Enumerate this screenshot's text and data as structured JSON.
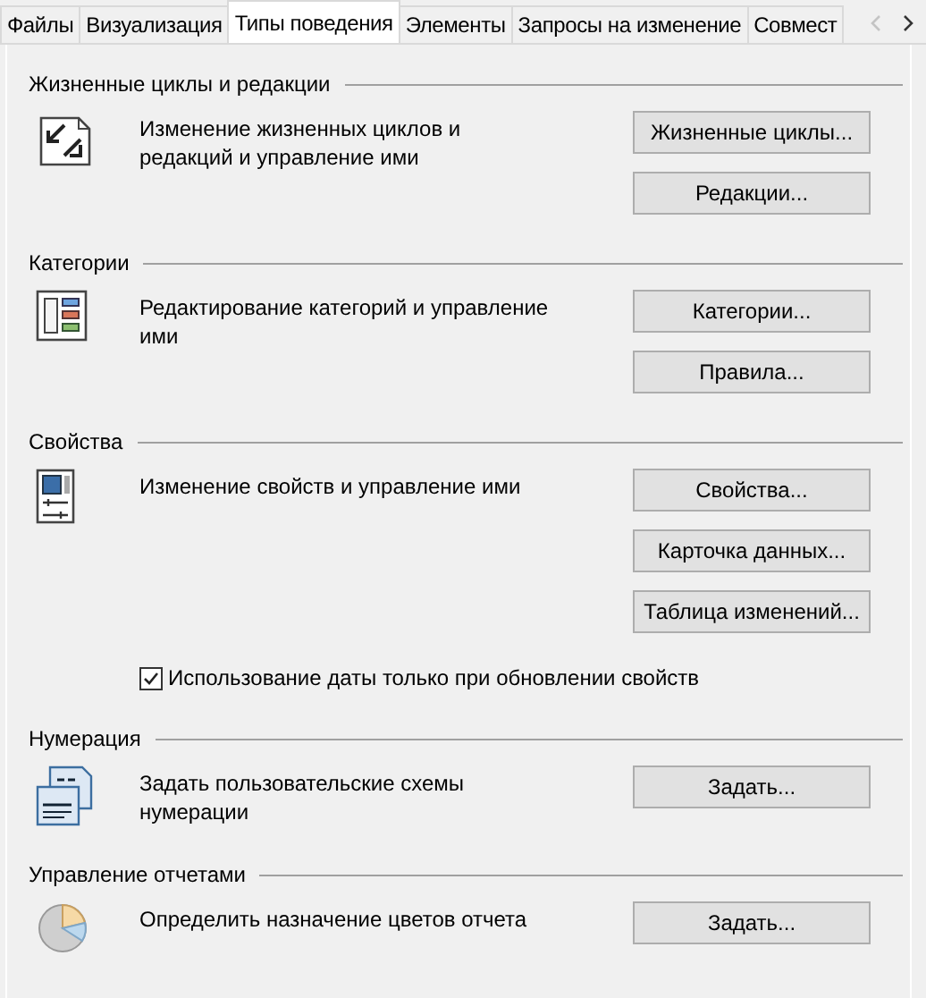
{
  "tabs": [
    {
      "label": "Файлы",
      "selected": false
    },
    {
      "label": "Визуализация",
      "selected": false
    },
    {
      "label": "Типы поведения",
      "selected": true
    },
    {
      "label": "Элементы",
      "selected": false
    },
    {
      "label": "Запросы на изменение",
      "selected": false
    },
    {
      "label": "Совмест",
      "selected": false
    }
  ],
  "sections": [
    {
      "title": "Жизненные циклы и редакции",
      "kind": "lifecycle",
      "description": "Изменение жизненных циклов и редакций и управление ими",
      "buttons": [
        "Жизненные циклы...",
        "Редакции..."
      ]
    },
    {
      "title": "Категории",
      "kind": "categories",
      "description": "Редактирование категорий и управление ими",
      "buttons": [
        "Категории...",
        "Правила..."
      ]
    },
    {
      "title": "Свойства",
      "kind": "properties",
      "description": "Изменение свойств и управление ими",
      "buttons": [
        "Свойства...",
        "Карточка данных...",
        "Таблица изменений..."
      ],
      "checkbox": {
        "label": "Использование даты только при обновлении свойств",
        "checked": true
      }
    },
    {
      "title": "Нумерация",
      "kind": "numbering",
      "description": "Задать пользовательские схемы нумерации",
      "buttons": [
        "Задать..."
      ]
    },
    {
      "title": "Управление отчетами",
      "kind": "reports",
      "description": "Определить назначение цветов отчета",
      "buttons": [
        "Задать..."
      ]
    }
  ]
}
